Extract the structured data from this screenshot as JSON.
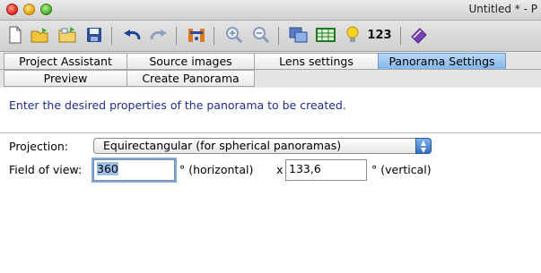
{
  "window": {
    "title": "Untitled * - P"
  },
  "toolbar": {
    "buttons": [
      {
        "icon": "new-document-icon"
      },
      {
        "icon": "open-folder-icon"
      },
      {
        "icon": "open-project-icon"
      },
      {
        "icon": "save-disk-icon"
      },
      {
        "icon": "undo-icon"
      },
      {
        "icon": "redo-icon"
      },
      {
        "icon": "control-points-icon"
      },
      {
        "icon": "zoom-in-icon"
      },
      {
        "icon": "zoom-out-icon"
      },
      {
        "icon": "preview-panorama-icon"
      },
      {
        "icon": "table-grid-icon"
      },
      {
        "icon": "lightbulb-icon"
      },
      {
        "icon": "numbers-icon",
        "label": "123"
      },
      {
        "icon": "help-book-icon"
      }
    ]
  },
  "tabs_row1": [
    "Project Assistant",
    "Source images",
    "Lens settings",
    "Panorama Settings"
  ],
  "tabs_row2": [
    "Preview",
    "Create Panorama"
  ],
  "active_tab": "Panorama Settings",
  "panel": {
    "intro": "Enter the desired properties of the panorama to be created.",
    "projection_label": "Projection:",
    "projection_value": "Equirectangular (for spherical panoramas)",
    "fov_label": "Field of view:",
    "fov_h_value": "360",
    "fov_h_unit": "° (horizontal)",
    "fov_x": "x",
    "fov_v_value": "133,6",
    "fov_v_unit": "° (vertical)"
  },
  "colors": {
    "active_tab": "#83b4e9",
    "intro_text": "#1f2c8a",
    "selection": "#9ec0e6"
  }
}
